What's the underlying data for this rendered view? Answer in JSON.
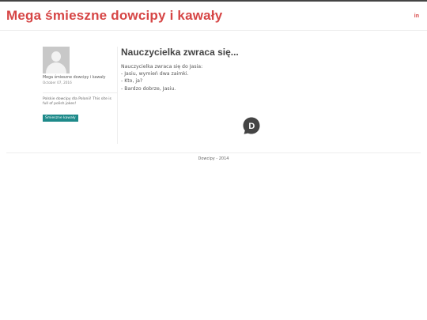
{
  "header": {
    "site_title": "Mega śmieszne dowcipy i kawały",
    "social_linkedin": "in"
  },
  "sidebar": {
    "author_name": "Mega śmieszne dowcipy i kawały",
    "post_date": "October 07, 2016",
    "blurb": "Polskie dowcipy dla Polonii! This site is full of polish jokes!",
    "tag_label": "Śmieszne kawały"
  },
  "post": {
    "title": "Nauczycielka zwraca się...",
    "lines": [
      "Nauczycielka zwraca się do Jasia:",
      "- Jasiu, wymień dwa zaimki.",
      "- Kto, ja?",
      "- Bardzo dobrze, Jasiu."
    ]
  },
  "disqus": {
    "letter": "D",
    "color": "#444444"
  },
  "footer": {
    "text": "Dowcipy - 2014"
  },
  "colors": {
    "brand": "#d64545",
    "tag": "#1e8a8a"
  }
}
